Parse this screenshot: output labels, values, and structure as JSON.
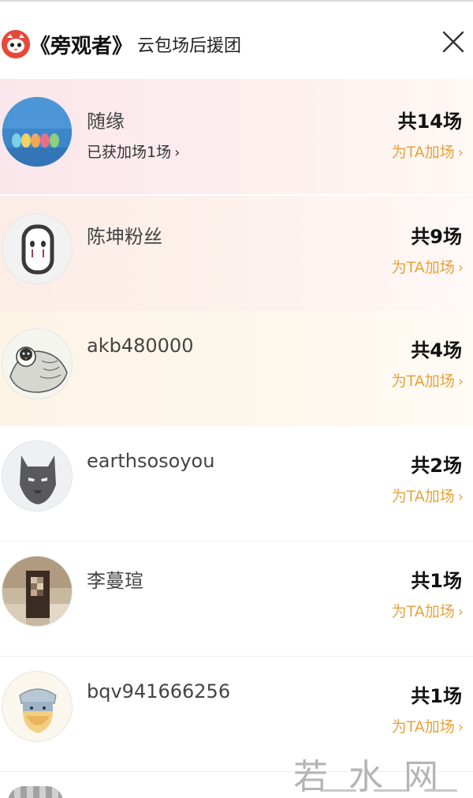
{
  "header": {
    "title_main": "《旁观者》",
    "title_sub": "云包场后援团",
    "close_label": "×"
  },
  "supporters": [
    {
      "name": "随缘",
      "sub_link": "已获加场1场",
      "count": "共14场",
      "add_link": "为TA加场",
      "avatar_icon": "landscape-avatar",
      "background": "#fbe7ec"
    },
    {
      "name": "陈坤粉丝",
      "count": "共9场",
      "add_link": "为TA加场",
      "avatar_icon": "mask-face-avatar",
      "background": "#fcefe8"
    },
    {
      "name": "akb480000",
      "count": "共4场",
      "add_link": "为TA加场",
      "avatar_icon": "penguin-sketch-avatar",
      "background": "#fdf6e6"
    },
    {
      "name": "earthsosoyou",
      "count": "共2场",
      "add_link": "为TA加场",
      "avatar_icon": "black-mask-avatar",
      "background": "#ffffff"
    },
    {
      "name": "李蔓瑄",
      "count": "共1场",
      "add_link": "为TA加场",
      "avatar_icon": "photo-avatar",
      "background": "#ffffff"
    },
    {
      "name": "bqv941666256",
      "count": "共1场",
      "add_link": "为TA加场",
      "avatar_icon": "cartoon-thor-avatar",
      "background": "#ffffff"
    }
  ],
  "watermark": "若水网",
  "colors": {
    "accent": "#e6a23c",
    "logo": "#e8483a"
  }
}
